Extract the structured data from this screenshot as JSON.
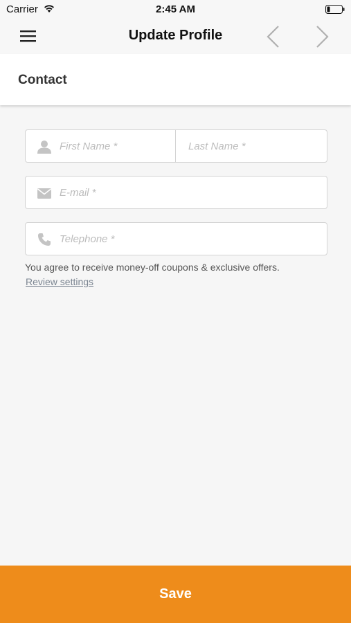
{
  "status_bar": {
    "carrier": "Carrier",
    "time": "2:45 AM",
    "wifi_icon": "wifi-icon",
    "battery_icon": "battery-low-icon"
  },
  "nav": {
    "title": "Update Profile",
    "menu_icon": "hamburger-menu-icon",
    "prev_icon": "chevron-left-icon",
    "next_icon": "chevron-right-icon"
  },
  "section": {
    "title": "Contact"
  },
  "form": {
    "first_name": {
      "value": "",
      "placeholder": "First Name *",
      "icon": "person-icon"
    },
    "last_name": {
      "value": "",
      "placeholder": "Last Name *"
    },
    "email": {
      "value": "",
      "placeholder": "E-mail *",
      "icon": "envelope-icon"
    },
    "telephone": {
      "value": "",
      "placeholder": "Telephone *",
      "icon": "phone-icon"
    }
  },
  "consent_text": "You agree to receive money-off coupons & exclusive offers.",
  "review_link": "Review settings",
  "save_label": "Save",
  "colors": {
    "accent": "#ee8c1b",
    "background": "#f6f6f6",
    "link": "#7b8591"
  }
}
